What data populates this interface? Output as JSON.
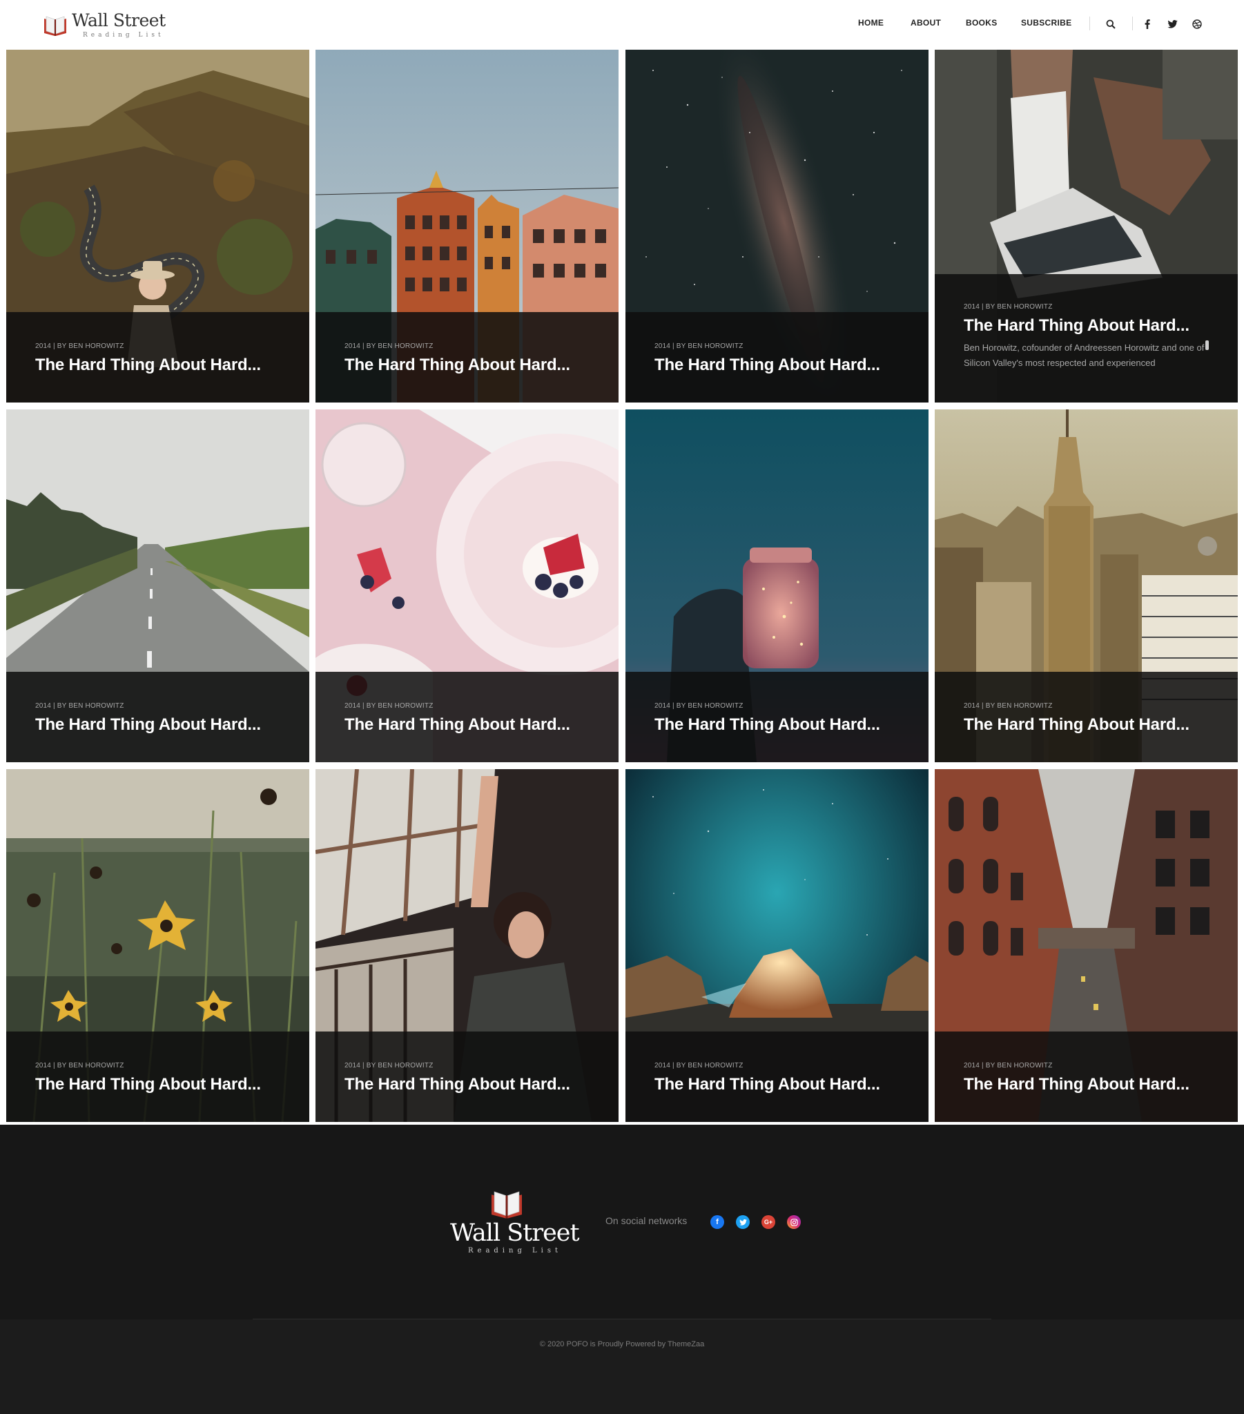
{
  "brand": {
    "name": "Wall Street",
    "tagline": "Reading List"
  },
  "nav": {
    "items": [
      {
        "label": "HOME"
      },
      {
        "label": "ABOUT"
      },
      {
        "label": "BOOKS"
      },
      {
        "label": "SUBSCRIBE"
      }
    ]
  },
  "header_icons": [
    "search-icon",
    "facebook-icon",
    "twitter-icon",
    "dribbble-icon"
  ],
  "posts": [
    {
      "meta": "2014 | BY BEN HOROWITZ",
      "title": "The Hard Thing About Hard...",
      "image": "mountain-road-woman"
    },
    {
      "meta": "2014 | BY BEN HOROWITZ",
      "title": "The Hard Thing About Hard...",
      "image": "colorful-buildings"
    },
    {
      "meta": "2014 | BY BEN HOROWITZ",
      "title": "The Hard Thing About Hard...",
      "image": "milky-way"
    },
    {
      "meta": "2014 | BY BEN HOROWITZ",
      "title": "The Hard Thing About Hard...",
      "image": "sneaker-weights",
      "excerpt": "Ben Horowitz, cofounder of Andreessen Horowitz and one of Silicon Valley's most respected and experienced"
    },
    {
      "meta": "2014 | BY BEN HOROWITZ",
      "title": "The Hard Thing About Hard...",
      "image": "foggy-highway"
    },
    {
      "meta": "2014 | BY BEN HOROWITZ",
      "title": "The Hard Thing About Hard...",
      "image": "dessert-plate"
    },
    {
      "meta": "2014 | BY BEN HOROWITZ",
      "title": "The Hard Thing About Hard...",
      "image": "glowing-jar"
    },
    {
      "meta": "2014 | BY BEN HOROWITZ",
      "title": "The Hard Thing About Hard...",
      "image": "empire-state-building"
    },
    {
      "meta": "2014 | BY BEN HOROWITZ",
      "title": "The Hard Thing About Hard...",
      "image": "wildflowers"
    },
    {
      "meta": "2014 | BY BEN HOROWITZ",
      "title": "The Hard Thing About Hard...",
      "image": "woman-greenhouse"
    },
    {
      "meta": "2014 | BY BEN HOROWITZ",
      "title": "The Hard Thing About Hard...",
      "image": "glowing-rock-stars"
    },
    {
      "meta": "2014 | BY BEN HOROWITZ",
      "title": "The Hard Thing About Hard...",
      "image": "brick-street-bridge"
    }
  ],
  "footer": {
    "social_label": "On social networks",
    "social_icons": [
      "facebook-icon",
      "twitter-icon",
      "google-plus-icon",
      "instagram-icon"
    ],
    "copyright": "© 2020 POFO is Proudly Powered by ThemeZaa"
  },
  "colors": {
    "overlay": "#0e0e0e",
    "footer_bg": "#171717",
    "brand_red": "#c0392b"
  }
}
